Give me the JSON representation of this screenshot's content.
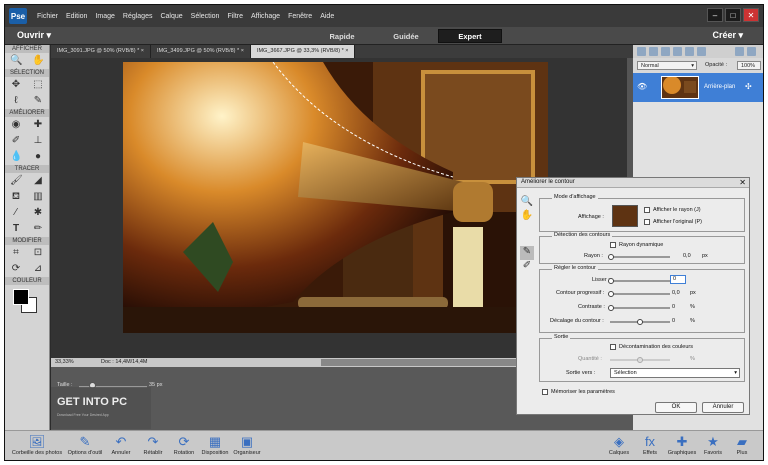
{
  "menu": {
    "items": [
      "Fichier",
      "Edition",
      "Image",
      "Réglages",
      "Calque",
      "Sélection",
      "Filtre",
      "Affichage",
      "Fenêtre",
      "Aide"
    ]
  },
  "topbar": {
    "open_label": "Ouvrir",
    "modes": [
      "Rapide",
      "Guidée",
      "Expert"
    ],
    "active_mode": "Expert",
    "create_label": "Créer"
  },
  "toolbox": {
    "sections": [
      "AFFICHER",
      "SÉLECTION",
      "AMÉLIORER",
      "TRACER",
      "MODIFIER",
      "COULEUR"
    ]
  },
  "doc_tabs": [
    "IMG_3091.JPG @ 50% (RVB/8) *",
    "IMG_3499.JPG @ 50% (RVB/8) *",
    "IMG_3667.JPG @ 33,3% (RVB/8) *"
  ],
  "status": {
    "zoom": "33,33%",
    "doc": "Doc : 14,4M/14,4M"
  },
  "options": {
    "size_label": "Taille :",
    "size_value": "35 px",
    "size_fraction": 0.35
  },
  "watermark": {
    "text": "GET INTO PC",
    "sub": "Download Free Your Desired App"
  },
  "layers": {
    "blend": "Normal",
    "opacity_label": "Opacité :",
    "opacity": "100%",
    "layer_name": "Arrière-plan"
  },
  "dialog": {
    "title": "Améliorer le contour",
    "view_mode": {
      "section": "Mode d'affichage",
      "view_label": "Affichage :",
      "show_radius": "Afficher le rayon (J)",
      "show_original": "Afficher l'original (P)"
    },
    "edge": {
      "section": "Détection des contours",
      "smart_radius": "Rayon dynamique",
      "radius_label": "Rayon :",
      "radius_value": "0,0",
      "radius_unit": "px"
    },
    "adjust": {
      "section": "Régler le contour",
      "smooth_label": "Lisser :",
      "smooth_value": "0",
      "feather_label": "Contour progressif :",
      "feather_value": "0,0",
      "feather_unit": "px",
      "contrast_label": "Contraste :",
      "contrast_value": "0",
      "contrast_unit": "%",
      "shift_label": "Décalage du contour :",
      "shift_value": "0",
      "shift_unit": "%"
    },
    "output": {
      "section": "Sortie",
      "decontam": "Décontamination des couleurs",
      "amount_label": "Quantité :",
      "amount_unit": "%",
      "output_to_label": "Sortie vers :",
      "output_to_value": "Sélection"
    },
    "remember": "Mémoriser les paramètres",
    "ok": "OK",
    "cancel": "Annuler"
  },
  "bottom": {
    "left": [
      "Corbeille des photos",
      "Options d'outil",
      "Annuler",
      "Rétablir",
      "Rotation",
      "Disposition",
      "Organiseur"
    ],
    "right": [
      "Calques",
      "Effets",
      "Graphiques",
      "Favoris",
      "Plus"
    ]
  },
  "colors": {
    "accent": "#3f7fd6",
    "expert_bg": "#1e1e1e"
  }
}
